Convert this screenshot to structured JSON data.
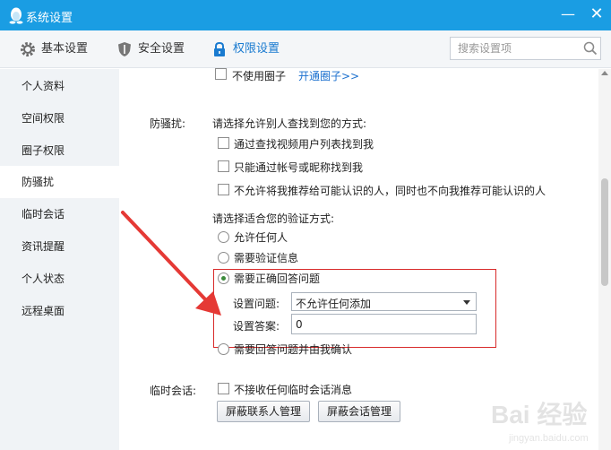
{
  "window": {
    "title": "系统设置",
    "min_label": "—",
    "close_label": "✕"
  },
  "toolbar": {
    "tabs": [
      {
        "label": "基本设置",
        "icon": "gear-icon"
      },
      {
        "label": "安全设置",
        "icon": "shield-icon"
      },
      {
        "label": "权限设置",
        "icon": "lock-icon",
        "active": true
      }
    ]
  },
  "search": {
    "placeholder": "搜索设置项",
    "value": ""
  },
  "sidebar": {
    "items": [
      {
        "label": "个人资料"
      },
      {
        "label": "空间权限"
      },
      {
        "label": "圈子权限"
      },
      {
        "label": "防骚扰",
        "active": true
      },
      {
        "label": "临时会话"
      },
      {
        "label": "资讯提醒"
      },
      {
        "label": "个人状态"
      },
      {
        "label": "远程桌面"
      }
    ]
  },
  "circle": {
    "checkbox_label": "不使用圈子",
    "link_label": "开通圈子>>"
  },
  "anti_harass": {
    "section_label": "防骚扰:",
    "find_prompt": "请选择允许别人查找到您的方式:",
    "find_options": [
      {
        "label": "通过查找视频用户列表找到我",
        "checked": false
      },
      {
        "label": "只能通过帐号或昵称找到我",
        "checked": false
      },
      {
        "label": "不允许将我推荐给可能认识的人，同时也不向我推荐可能认识的人",
        "checked": false
      }
    ],
    "verify_prompt": "请选择适合您的验证方式:",
    "verify_options": [
      {
        "label": "允许任何人",
        "checked": false
      },
      {
        "label": "需要验证信息",
        "checked": false
      },
      {
        "label": "需要正确回答问题",
        "checked": true
      },
      {
        "label": "需要回答问题并由我确认",
        "checked": false
      }
    ],
    "question_label": "设置问题:",
    "question_value": "不允许任何添加",
    "answer_label": "设置答案:",
    "answer_value": "0"
  },
  "temp_session": {
    "section_label": "临时会话:",
    "checkbox_label": "不接收任何临时会话消息",
    "checked": false,
    "buttons": [
      "屏蔽联系人管理",
      "屏蔽会话管理"
    ]
  },
  "watermark": {
    "text": "Bai 经验",
    "subtext": "jingyan.baidu.com"
  },
  "colors": {
    "titlebar": "#1a9de3",
    "accent": "#1a7bd0",
    "highlight": "#d82a2a",
    "arrow": "#e53935",
    "radio_fill": "#3b8a3b"
  }
}
